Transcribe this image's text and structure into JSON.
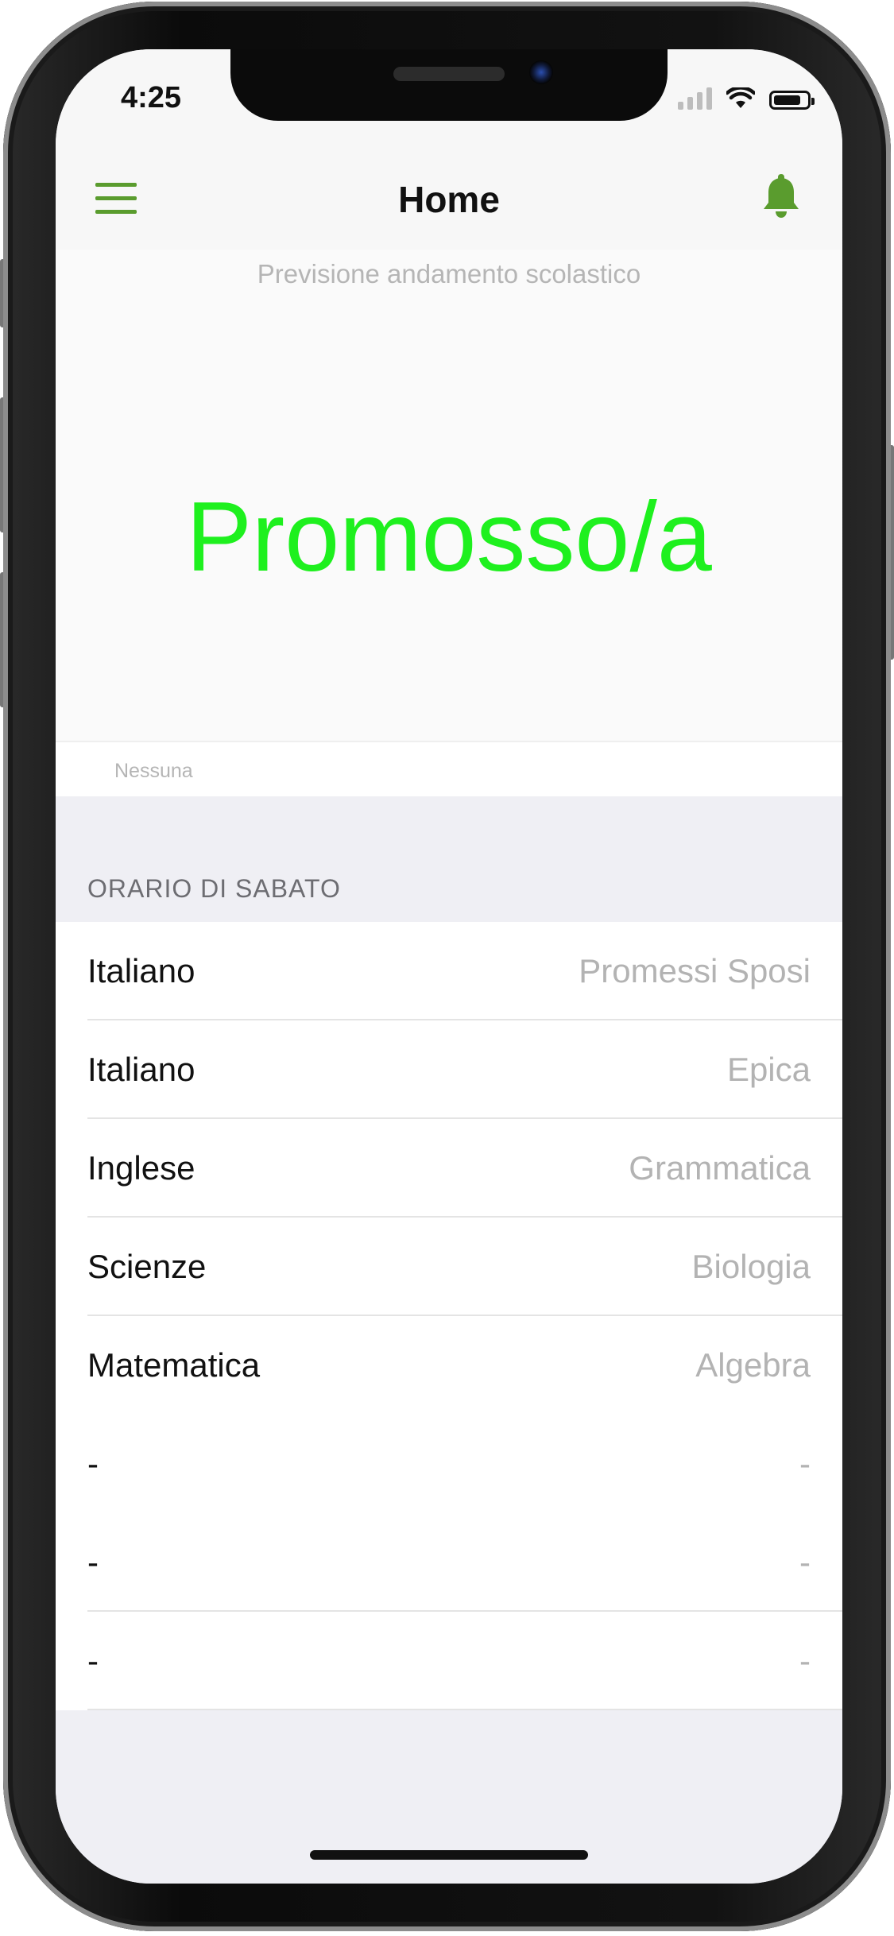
{
  "status_bar": {
    "time": "4:25"
  },
  "nav": {
    "title": "Home"
  },
  "prediction": {
    "caption": "Previsione andamento scolastico",
    "value": "Promosso/a",
    "value_color": "#1ef01e",
    "note": "Nessuna"
  },
  "schedule": {
    "header": "ORARIO DI SABATO",
    "rows": [
      {
        "subject": "Italiano",
        "topic": "Promessi Sposi"
      },
      {
        "subject": "Italiano",
        "topic": "Epica"
      },
      {
        "subject": "Inglese",
        "topic": "Grammatica"
      },
      {
        "subject": "Scienze",
        "topic": "Biologia"
      },
      {
        "subject": "Matematica",
        "topic": "Algebra"
      },
      {
        "subject": "-",
        "topic": "-"
      },
      {
        "subject": "-",
        "topic": "-"
      },
      {
        "subject": "-",
        "topic": "-"
      }
    ]
  },
  "icons": {
    "menu": "hamburger-menu-icon",
    "notifications": "bell-icon",
    "accent_color": "#5a9c2e"
  }
}
